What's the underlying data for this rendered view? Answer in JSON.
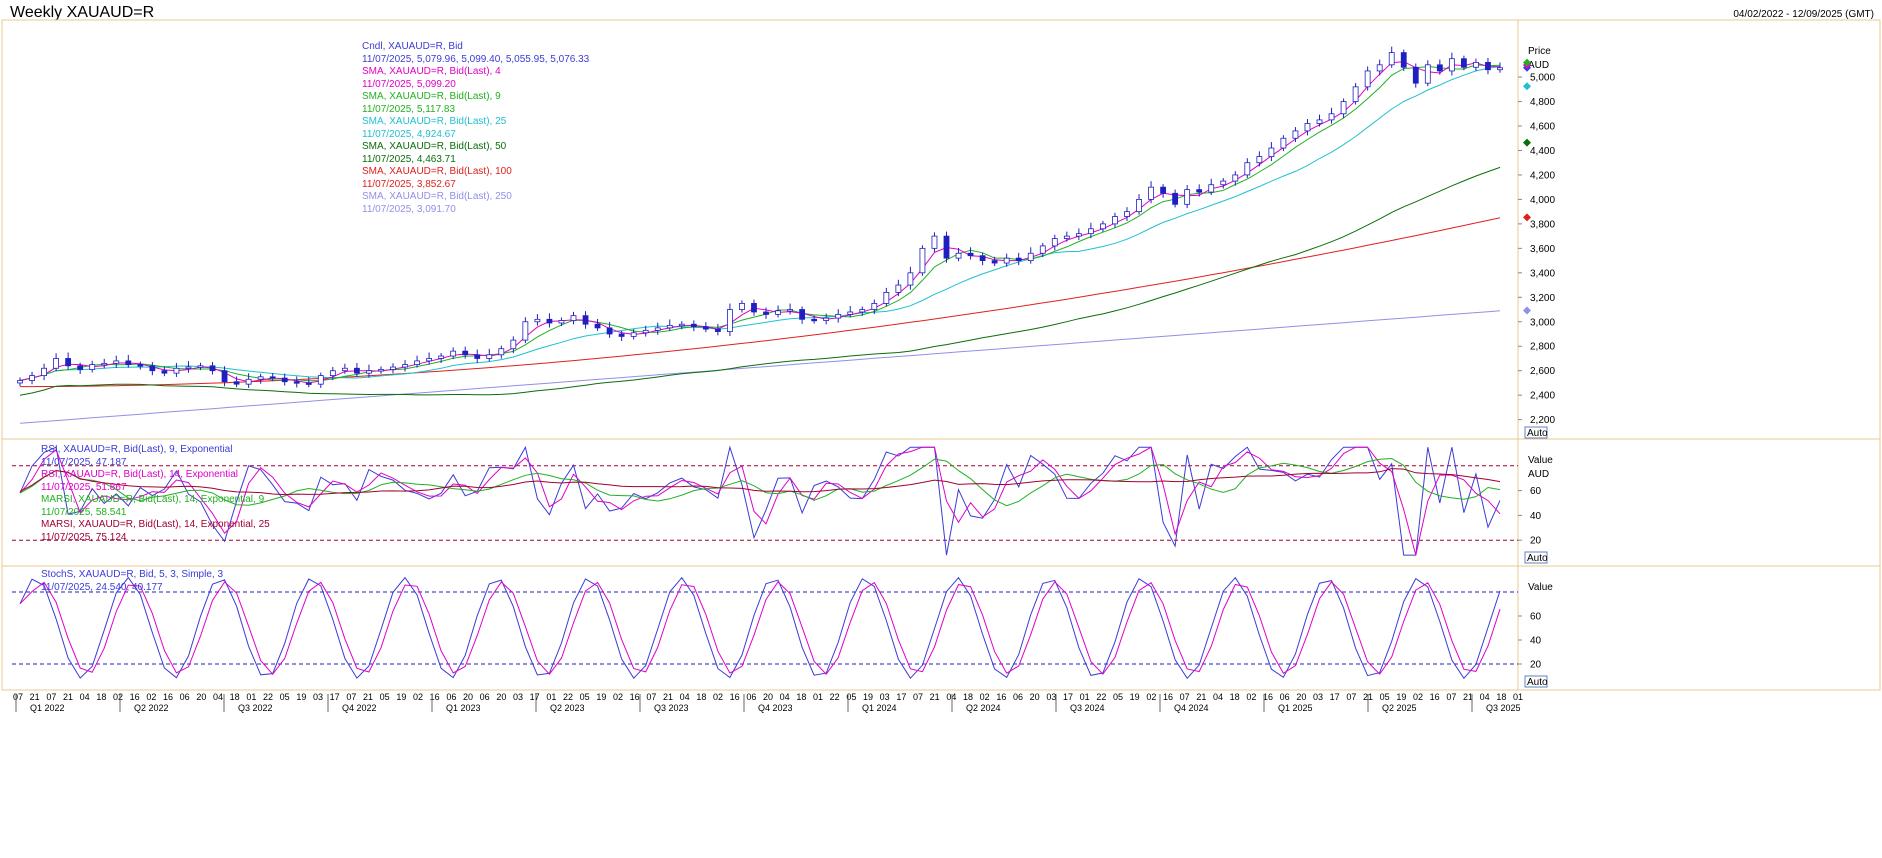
{
  "title": "Weekly XAUAUD=R",
  "date_range": "04/02/2022 - 12/09/2025 (GMT)",
  "chart_data": [
    {
      "type": "candlestick",
      "legend": [
        {
          "label": "Cndl, XAUAUD=R, Bid",
          "value": "11/07/2025, 5,079.96, 5,099.40, 5,055.95, 5,076.33",
          "color": "#3b3bd6"
        },
        {
          "label": "SMA, XAUAUD=R, Bid(Last), 4",
          "value": "11/07/2025, 5,099.20",
          "color": "#e000c8"
        },
        {
          "label": "SMA, XAUAUD=R, Bid(Last), 9",
          "value": "11/07/2025, 5,117.83",
          "color": "#22b022"
        },
        {
          "label": "SMA, XAUAUD=R, Bid(Last), 25",
          "value": "11/07/2025, 4,924.67",
          "color": "#20c0d0"
        },
        {
          "label": "SMA, XAUAUD=R, Bid(Last), 50",
          "value": "11/07/2025, 4,463.71",
          "color": "#0a6e0a"
        },
        {
          "label": "SMA, XAUAUD=R, Bid(Last), 100",
          "value": "11/07/2025, 3,852.67",
          "color": "#e02020"
        },
        {
          "label": "SMA, XAUAUD=R, Bid(Last), 250",
          "value": "11/07/2025, 3,091.70",
          "color": "#9090e8"
        }
      ],
      "axis_title": "Price",
      "axis_unit": "AUD",
      "ylim": [
        2050,
        5450
      ],
      "yticks": [
        "2,200",
        "2,400",
        "2,600",
        "2,800",
        "3,000",
        "3,200",
        "3,400",
        "3,600",
        "3,800",
        "4,000",
        "4,200",
        "4,400",
        "4,600",
        "4,800",
        "5,000"
      ],
      "auto_label": "Auto",
      "close_series": [
        2520,
        2560,
        2620,
        2700,
        2640,
        2610,
        2650,
        2660,
        2680,
        2650,
        2640,
        2600,
        2580,
        2620,
        2630,
        2640,
        2600,
        2510,
        2490,
        2530,
        2550,
        2540,
        2510,
        2500,
        2490,
        2560,
        2600,
        2620,
        2580,
        2600,
        2610,
        2630,
        2650,
        2680,
        2700,
        2720,
        2760,
        2730,
        2700,
        2730,
        2780,
        2850,
        3000,
        3020,
        2990,
        3010,
        3050,
        2980,
        2950,
        2900,
        2880,
        2910,
        2930,
        2950,
        2970,
        2980,
        2960,
        2940,
        2920,
        3100,
        3150,
        3080,
        3060,
        3090,
        3100,
        3020,
        3010,
        3030,
        3060,
        3080,
        3100,
        3150,
        3240,
        3300,
        3400,
        3600,
        3700,
        3520,
        3560,
        3540,
        3500,
        3480,
        3520,
        3500,
        3560,
        3620,
        3680,
        3700,
        3720,
        3760,
        3800,
        3860,
        3900,
        4000,
        4100,
        4050,
        3960,
        4080,
        4060,
        4120,
        4150,
        4200,
        4300,
        4350,
        4420,
        4500,
        4560,
        4620,
        4650,
        4700,
        4800,
        4920,
        5050,
        5100,
        5200,
        5080,
        4950,
        5100,
        5050,
        5150,
        5080,
        5120,
        5060,
        5076
      ]
    },
    {
      "type": "line",
      "legend": [
        {
          "label": "RSI, XAUAUD=R, Bid(Last), 9, Exponential",
          "value": "11/07/2025, 47.187",
          "color": "#3b3bd6"
        },
        {
          "label": "RSI, XAUAUD=R, Bid(Last), 14, Exponential",
          "value": "11/07/2025, 51.867",
          "color": "#e000c8"
        },
        {
          "label": "MARSI, XAUAUD=R, Bid(Last), 14, Exponential, 9",
          "value": "11/07/2025, 58.541",
          "color": "#22b022"
        },
        {
          "label": "MARSI, XAUAUD=R, Bid(Last), 14, Exponential, 25",
          "value": "11/07/2025, 75.124",
          "color": "#a00030"
        }
      ],
      "axis_title": "Value",
      "axis_unit": "AUD",
      "ylim": [
        0,
        100
      ],
      "yticks": [
        "20",
        "40",
        "60"
      ],
      "hlines": [
        20,
        80
      ],
      "auto_label": "Auto"
    },
    {
      "type": "line",
      "legend": [
        {
          "label": "StochS, XAUAUD=R, Bid,  5, 3, Simple, 3",
          "value": "11/07/2025, 24.540, 40.177",
          "color": "#3b3bd6"
        }
      ],
      "axis_title": "Value",
      "ylim": [
        0,
        100
      ],
      "yticks": [
        "20",
        "40",
        "60"
      ],
      "hlines": [
        20,
        80
      ],
      "auto_label": "Auto"
    }
  ],
  "x_axis": {
    "day_ticks": [
      "07",
      "21",
      "07",
      "21",
      "04",
      "18",
      "02",
      "16",
      "02",
      "16",
      "06",
      "20",
      "04",
      "18",
      "01",
      "22",
      "05",
      "19",
      "03",
      "17",
      "07",
      "21",
      "05",
      "19",
      "02",
      "16",
      "06",
      "20",
      "06",
      "20",
      "03",
      "17",
      "01",
      "22",
      "05",
      "19",
      "02",
      "16",
      "07",
      "21",
      "04",
      "18",
      "02",
      "16",
      "06",
      "20",
      "04",
      "18",
      "01",
      "22",
      "05",
      "19",
      "03",
      "17",
      "07",
      "21",
      "04",
      "18",
      "02",
      "16",
      "06",
      "20",
      "03",
      "17",
      "01",
      "22",
      "05",
      "19",
      "02",
      "16",
      "07",
      "21",
      "04",
      "18",
      "02",
      "16",
      "06",
      "20",
      "03",
      "17",
      "07",
      "21",
      "05",
      "19",
      "02",
      "16",
      "07",
      "21",
      "04",
      "18",
      "01"
    ],
    "quarter_labels": [
      "Q1 2022",
      "Q2 2022",
      "Q3 2022",
      "Q4 2022",
      "Q1 2023",
      "Q2 2023",
      "Q3 2023",
      "Q4 2023",
      "Q1 2024",
      "Q2 2024",
      "Q3 2024",
      "Q4 2024",
      "Q1 2025",
      "Q2 2025",
      "Q3 2025"
    ]
  }
}
